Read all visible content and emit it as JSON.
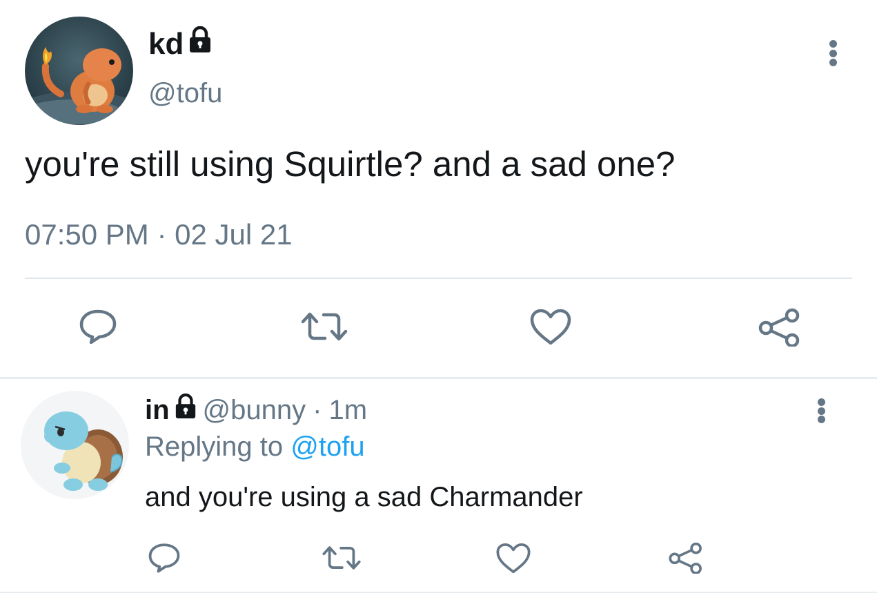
{
  "main_tweet": {
    "author_name": "kd",
    "author_handle": "@tofu",
    "text": "you're still using Squirtle? and a sad one?",
    "timestamp": "07:50 PM · 02 Jul 21",
    "avatar": "charmander-avatar",
    "locked": true,
    "actions": [
      "reply-icon",
      "retweet-icon",
      "like-icon",
      "share-icon"
    ]
  },
  "reply_tweet": {
    "author_name": "in",
    "author_handle": "@bunny",
    "separator": "·",
    "time_ago": "1m",
    "replying_prefix": "Replying to",
    "replying_mention": "@tofu",
    "text": "and you're using a sad Charmander",
    "avatar": "squirtle-avatar",
    "locked": true,
    "actions": [
      "reply-icon",
      "retweet-icon",
      "like-icon",
      "share-icon"
    ]
  },
  "colors": {
    "text_primary": "#14171a",
    "text_secondary": "#657786",
    "link": "#1da1f2",
    "divider": "#e1e8ed"
  }
}
